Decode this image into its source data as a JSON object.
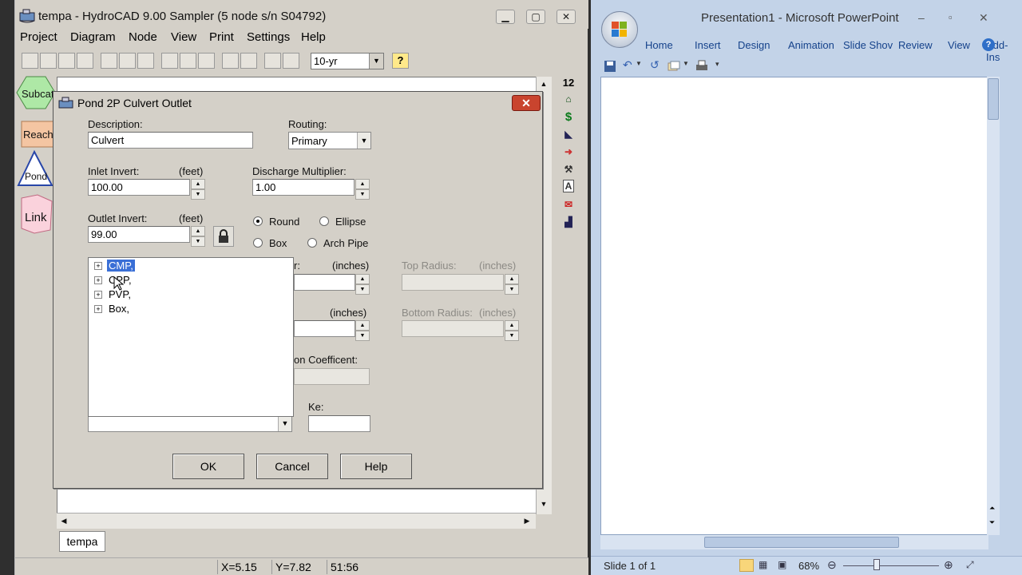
{
  "hydrocad": {
    "title": "tempa - HydroCAD 9.00 Sampler (5 node s/n S04792)",
    "menu": [
      "Project",
      "Diagram",
      "Node",
      "View",
      "Print",
      "Settings",
      "Help"
    ],
    "storm_select": "10-yr",
    "help_button": "?",
    "palette": {
      "subcat": "Subcat",
      "reach": "Reach",
      "pond": "Pond",
      "link": "Link"
    },
    "right_toolbar": {
      "numbers": "12",
      "dollar": "$"
    },
    "sheet_tab": "tempa",
    "status": {
      "x": "X=5.15",
      "y": "Y=7.82",
      "time": "51:56"
    }
  },
  "dialog": {
    "title": "Pond 2P Culvert Outlet",
    "close": "✕",
    "description_label": "Description:",
    "description_value": "Culvert",
    "routing_label": "Routing:",
    "routing_value": "Primary",
    "inlet_label": "Inlet Invert:",
    "inlet_unit": "(feet)",
    "inlet_value": "100.00",
    "discharge_label": "Discharge Multiplier:",
    "discharge_value": "1.00",
    "outlet_label": "Outlet Invert:",
    "outlet_unit": "(feet)",
    "outlet_value": "99.00",
    "shape_round": "Round",
    "shape_ellipse": "Ellipse",
    "shape_box": "Box",
    "shape_arch": "Arch Pipe",
    "diameter_partial": "r:",
    "inches": "(inches)",
    "top_radius_label": "Top Radius:",
    "bottom_radius_label": "Bottom Radius:",
    "coef_partial": "on Coefficent:",
    "ke_label": "Ke:",
    "tree": [
      "CMP,",
      "CPP,",
      "PVP,",
      "Box,"
    ],
    "ok": "OK",
    "cancel": "Cancel",
    "help": "Help"
  },
  "powerpoint": {
    "title": "Presentation1 - Microsoft PowerPoint",
    "tabs": [
      "Home",
      "Insert",
      "Design",
      "Animation",
      "Slide Shov",
      "Review",
      "View",
      "Add-Ins"
    ],
    "status_slide": "Slide 1 of 1",
    "zoom": "68%"
  }
}
